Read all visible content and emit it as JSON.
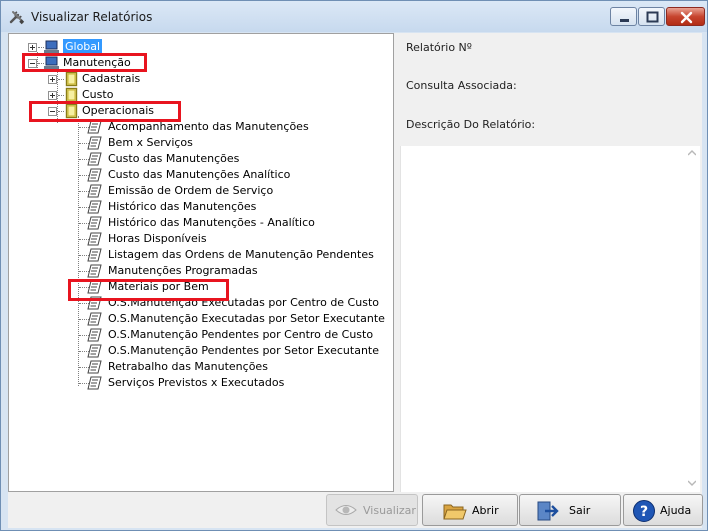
{
  "window": {
    "title": "Visualizar Relatórios"
  },
  "tree": {
    "global": "Global",
    "manutencao": "Manutenção",
    "cadastrais": "Cadastrais",
    "custo": "Custo",
    "operacionais": "Operacionais",
    "reports": [
      "Acompanhamento das Manutenções",
      "Bem x Serviços",
      "Custo das Manutenções",
      "Custo das Manutenções Analítico",
      "Emissão de Ordem de Serviço",
      "Histórico das Manutenções",
      "Histórico das Manutenções - Analítico",
      "Horas Disponíveis",
      "Listagem das Ordens de Manutenção Pendentes",
      "Manutenções Programadas",
      "Materiais por Bem",
      "O.S.Manutenção Executadas por Centro de Custo",
      "O.S.Manutenção Executadas por Setor Executante",
      "O.S.Manutenção Pendentes por Centro de Custo",
      "O.S.Manutenção Pendentes por Setor Executante",
      "Retrabalho das Manutenções",
      "Serviços Previstos x Executados"
    ]
  },
  "details": {
    "relatorio_label": "Relatório Nº",
    "consulta_label": "Consulta Associada:",
    "descricao_label": "Descrição Do Relatório:"
  },
  "buttons": {
    "visualizar": "Visualizar",
    "abrir": "Abrir",
    "sair": "Sair",
    "ajuda": "Ajuda"
  },
  "colors": {
    "highlight": "#e8141f",
    "selection": "#3399ff"
  }
}
